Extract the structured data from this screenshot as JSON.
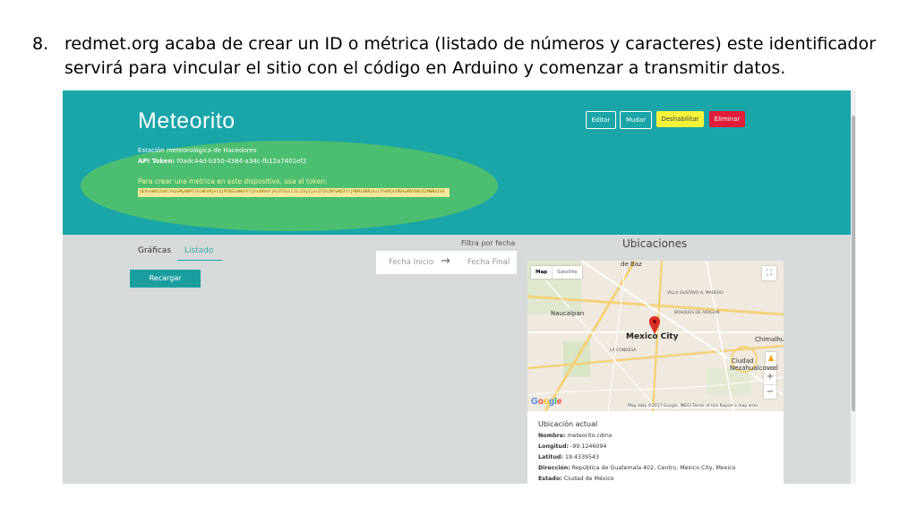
{
  "caption": {
    "number": "8.",
    "text": "redmet.org acaba de crear un ID o métrica (listado de números y caracteres) este identificador servirá para vincular el sitio con el código en Arduino y comenzar a transmitir datos."
  },
  "header": {
    "title": "Meteorito",
    "subtitle": "Estación meteorológica de Hacedores",
    "api_token_label": "API Token:",
    "api_token_value": "f0adc44d-b350-4384-a34c-fb12a7401ef2",
    "instructions": "Para crear una metrica en este dispositivo, usa el token:",
    "metric_token": "OEVvbWV1ZmVlYmIwMy00MTJkLWFkMjktZjM1NS1mMmFhYjExOWVmYjRiOTAiLCJ1c2VyIjoiOTZhZWYwNDItYjM0Mi00NjkxLThkMjktMDAwMDY0NjQ3MWNmIn0"
  },
  "actions": {
    "edit": "Editar",
    "move": "Mudar",
    "disable": "Deshabilitar",
    "delete": "Eliminar"
  },
  "tabs": [
    "Gráficas",
    "Listado"
  ],
  "reload_button": "Recargar",
  "filter": {
    "label": "Filtra por fecha",
    "start_placeholder": "Fecha Inicio",
    "arrow": "→",
    "end_placeholder": "Fecha Final"
  },
  "locations": {
    "title": "Ubicaciones",
    "map": {
      "type_map": "Map",
      "type_satellite": "Satellite",
      "city_label": "Mexico City",
      "labels": [
        "Naucalpan",
        "Chimalhu",
        "Ciudad",
        "Nezahualcoyotl",
        "VILLA GUSTAVO A. MADERO",
        "BOSQUES DE ARAGON",
        "LA CONDESA",
        "de Baz"
      ],
      "attribution": "Map data ©2017 Google, INEGI   Terms of Use   Report a map error",
      "google_logo": "Google",
      "zoom_in": "+",
      "zoom_out": "−"
    },
    "current": {
      "title": "Ubicación actual",
      "rows": [
        {
          "label": "Nombre:",
          "value": "meteorito.cdmx"
        },
        {
          "label": "Longitud:",
          "value": "-99.1246094"
        },
        {
          "label": "Latitud:",
          "value": "19.4339543"
        },
        {
          "label": "Dirección:",
          "value": "República de Guatemala 402, Centro, Mexico City, Mexico"
        },
        {
          "label": "Estado:",
          "value": "Ciudad de México"
        }
      ]
    }
  },
  "colors": {
    "banner": "#1aa5a9",
    "highlight": "#4cbe70",
    "disable_button": "#f6f33a",
    "delete_button": "#e01d3a"
  }
}
